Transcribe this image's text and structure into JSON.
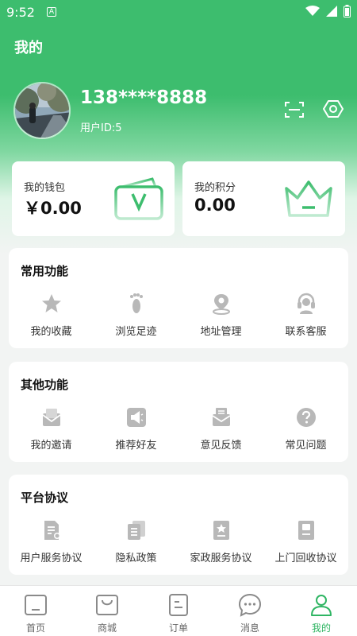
{
  "status_bar": {
    "time": "9:52",
    "notification_letter": "A"
  },
  "header": {
    "title": "我的"
  },
  "profile": {
    "phone": "138****8888",
    "user_id": "用户ID:5"
  },
  "wallet": {
    "label": "我的钱包",
    "value": "￥0.00"
  },
  "points": {
    "label": "我的积分",
    "value": "0.00"
  },
  "common": {
    "title": "常用功能",
    "items": [
      {
        "label": "我的收藏",
        "icon": "star-icon"
      },
      {
        "label": "浏览足迹",
        "icon": "footprint-icon"
      },
      {
        "label": "地址管理",
        "icon": "location-icon"
      },
      {
        "label": "联系客服",
        "icon": "headset-icon"
      }
    ]
  },
  "other": {
    "title": "其他功能",
    "items": [
      {
        "label": "我的邀请",
        "icon": "invite-icon"
      },
      {
        "label": "推荐好友",
        "icon": "megaphone-icon"
      },
      {
        "label": "意见反馈",
        "icon": "feedback-icon"
      },
      {
        "label": "常见问题",
        "icon": "question-icon"
      }
    ]
  },
  "agreements": {
    "title": "平台协议",
    "items": [
      {
        "label": "用户服务协议",
        "icon": "document-icon"
      },
      {
        "label": "隐私政策",
        "icon": "documents-icon"
      },
      {
        "label": "家政服务协议",
        "icon": "certificate-icon"
      },
      {
        "label": "上门回收协议",
        "icon": "book-icon"
      }
    ]
  },
  "tabbar": {
    "items": [
      {
        "label": "首页",
        "icon": "home-icon"
      },
      {
        "label": "商城",
        "icon": "shopping-bag-icon"
      },
      {
        "label": "订单",
        "icon": "order-icon"
      },
      {
        "label": "消息",
        "icon": "message-icon"
      },
      {
        "label": "我的",
        "icon": "user-icon",
        "active": true
      }
    ]
  },
  "colors": {
    "primary": "#3dbd6e",
    "icon_gray": "#b8b8b8",
    "active_tab": "#2fb563"
  }
}
